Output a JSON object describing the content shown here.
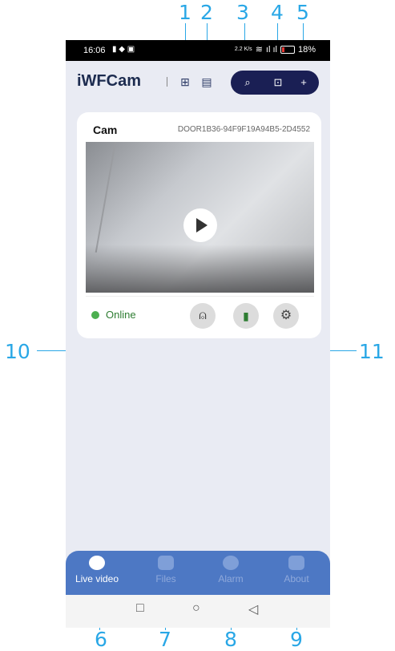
{
  "status_bar": {
    "time": "16:06",
    "right_text": "2.2 K/s",
    "battery_pct": "18%"
  },
  "app": {
    "title": "iWFCam"
  },
  "device": {
    "name": "Cam",
    "uid": "DOOR1B36-94F9F19A94B5-2D4552",
    "status": "Online"
  },
  "nav": {
    "tabs": [
      {
        "label": "Live video"
      },
      {
        "label": "Files"
      },
      {
        "label": "Alarm"
      },
      {
        "label": "About"
      }
    ]
  },
  "callouts": {
    "c1": "1",
    "c2": "2",
    "c3": "3",
    "c4": "4",
    "c5": "5",
    "c6": "6",
    "c7": "7",
    "c8": "8",
    "c9": "9",
    "c10": "10",
    "c11": "11"
  },
  "colors": {
    "accent": "#29a7e6",
    "nav_bg": "#4d78c4",
    "pill_bg": "#1a1f54",
    "online": "#4caf50"
  }
}
